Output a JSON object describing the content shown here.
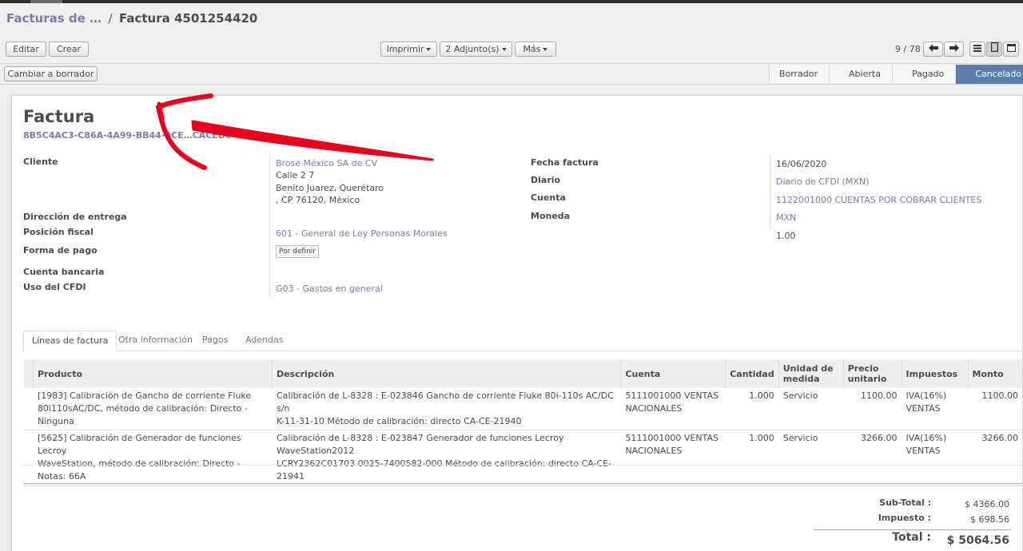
{
  "breadcrumb": {
    "parent": "Facturas de …",
    "separator": "/",
    "current": "Factura 4501254420"
  },
  "toolbar": {
    "edit": "Editar",
    "create": "Crear",
    "print": "Imprimir",
    "attachments": "2 Adjunto(s)",
    "more": "Más",
    "pager": "9 / 78"
  },
  "statusbar": {
    "draft_button": "Cambiar a borrador",
    "steps": [
      "Borrador",
      "Abierta",
      "Pagado",
      "Cancelado"
    ],
    "active_step": "Cancelado"
  },
  "form": {
    "title": "Factura",
    "uuid": "8B5C4AC3-C86A-4A99-BB44-9CE…CACED6",
    "left": {
      "cliente_label": "Cliente",
      "cliente_name": "Brose México SA de CV",
      "cliente_addr1": "Calle 2 7",
      "cliente_addr2": "Benito Juarez, Querétaro",
      "cliente_addr3": ", CP 76120, México",
      "entrega_label": "Dirección de entrega",
      "posicion_label": "Posición fiscal",
      "posicion_value": "601 - General de Ley Personas Morales",
      "forma_label": "Forma de pago",
      "forma_value": "Por definir",
      "banco_label": "Cuenta bancaria",
      "cfdi_label": "Uso del CFDI",
      "cfdi_value": "G03 - Gastos en general"
    },
    "right": {
      "fecha_label": "Fecha factura",
      "fecha_value": "16/06/2020",
      "diario_label": "Diario",
      "diario_value": "Diario de CFDI (MXN)",
      "cuenta_label": "Cuenta",
      "cuenta_value": "1122001000 CUENTAS POR COBRAR CLIENTES",
      "moneda_label": "Moneda",
      "moneda_value": "MXN",
      "rate_value": "1.00"
    }
  },
  "tabs": [
    "Líneas de factura",
    "Otra información",
    "Pagos",
    "Adendas"
  ],
  "table": {
    "headers": {
      "producto": "Producto",
      "descripcion": "Descripción",
      "cuenta": "Cuenta",
      "cantidad": "Cantidad",
      "unidad1": "Unidad de",
      "unidad2": "medida",
      "precio1": "Precio",
      "precio2": "unitario",
      "impuestos": "Impuestos",
      "monto": "Monto"
    },
    "rows": [
      {
        "producto1": "[1983] Calibración de Gancho de corriente Fluke",
        "producto2": "80i110sAC/DC, método de calibración: Directo - Ninguna",
        "desc1": "Calibración de L-8328 : E-023846 Gancho de corriente Fluke 80i-110s AC/DC s/n",
        "desc2": "K-11-31-10 Método de calibración: directo CA-CE-21940",
        "cuenta1": "5111001000 VENTAS",
        "cuenta2": "NACIONALES",
        "cantidad": "1.000",
        "unidad": "Servicio",
        "precio": "1100.00",
        "imp1": "IVA(16%)",
        "imp2": "VENTAS",
        "monto": "1100.00"
      },
      {
        "producto1": "[5625] Calibración de Generador de funciones Lecroy",
        "producto2": "WaveStation, método de calibración: Directo - Notas: 66A",
        "desc1": "Calibración de L-8328 : E-023847 Generador de funciones Lecroy WaveStation2012",
        "desc2": "LCRY2362C01703 0025-7400582-000 Método de calibración: directo CA-CE-21941",
        "cuenta1": "5111001000 VENTAS",
        "cuenta2": "NACIONALES",
        "cantidad": "1.000",
        "unidad": "Servicio",
        "precio": "3266.00",
        "imp1": "IVA(16%)",
        "imp2": "VENTAS",
        "monto": "3266.00"
      }
    ]
  },
  "totals": {
    "subtotal_label": "Sub-Total :",
    "subtotal_value": "$ 4366.00",
    "tax_label": "Impuesto :",
    "tax_value": "$ 698.56",
    "total_label": "Total :",
    "total_value": "$ 5064.56"
  },
  "colors": {
    "link": "#7c7bad",
    "active_step": "#5a7fad",
    "annotation": "#e8001c"
  }
}
